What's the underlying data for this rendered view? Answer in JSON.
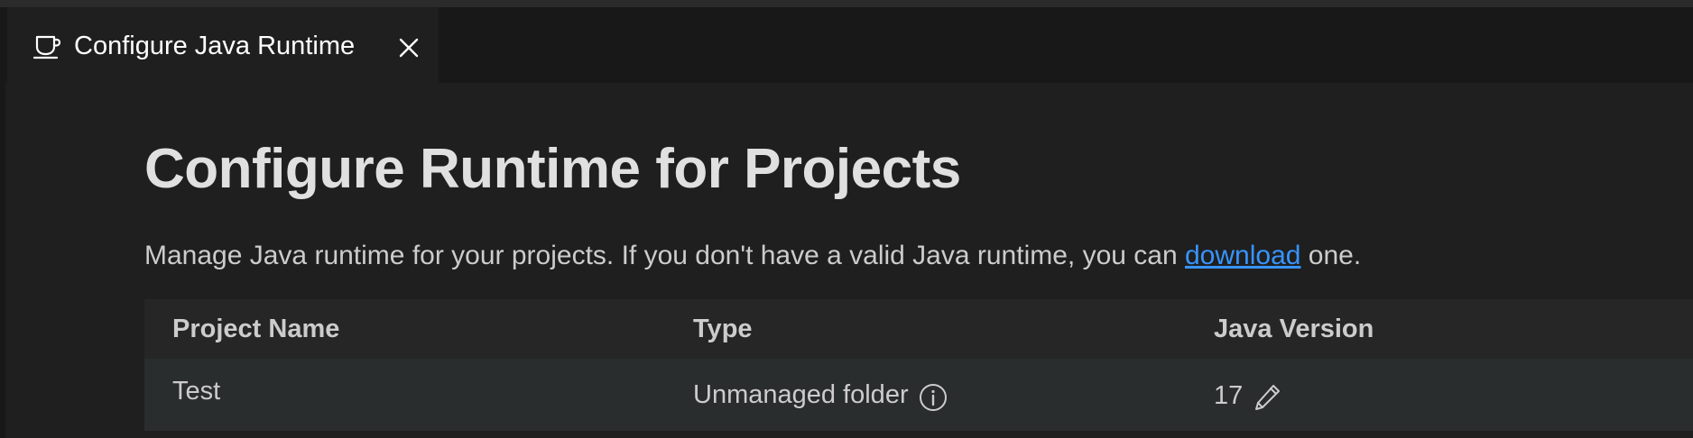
{
  "tab": {
    "title": "Configure Java Runtime",
    "icon": "coffee-cup-icon",
    "close_icon": "close-icon"
  },
  "page": {
    "title": "Configure Runtime for Projects",
    "description_before": "Manage Java runtime for your projects. If you don't have a valid Java runtime, you can ",
    "description_link": "download",
    "description_after": " one."
  },
  "table": {
    "headers": [
      "Project Name",
      "Type",
      "Java Version"
    ],
    "rows": [
      {
        "project_name": "Test",
        "type": "Unmanaged folder",
        "type_icon": "info-icon",
        "java_version": "17",
        "version_icon": "pencil-icon"
      }
    ]
  },
  "colors": {
    "background": "#1f1f1f",
    "link": "#3794ff",
    "header_row": "#262626",
    "data_row": "#2a2d2e"
  }
}
